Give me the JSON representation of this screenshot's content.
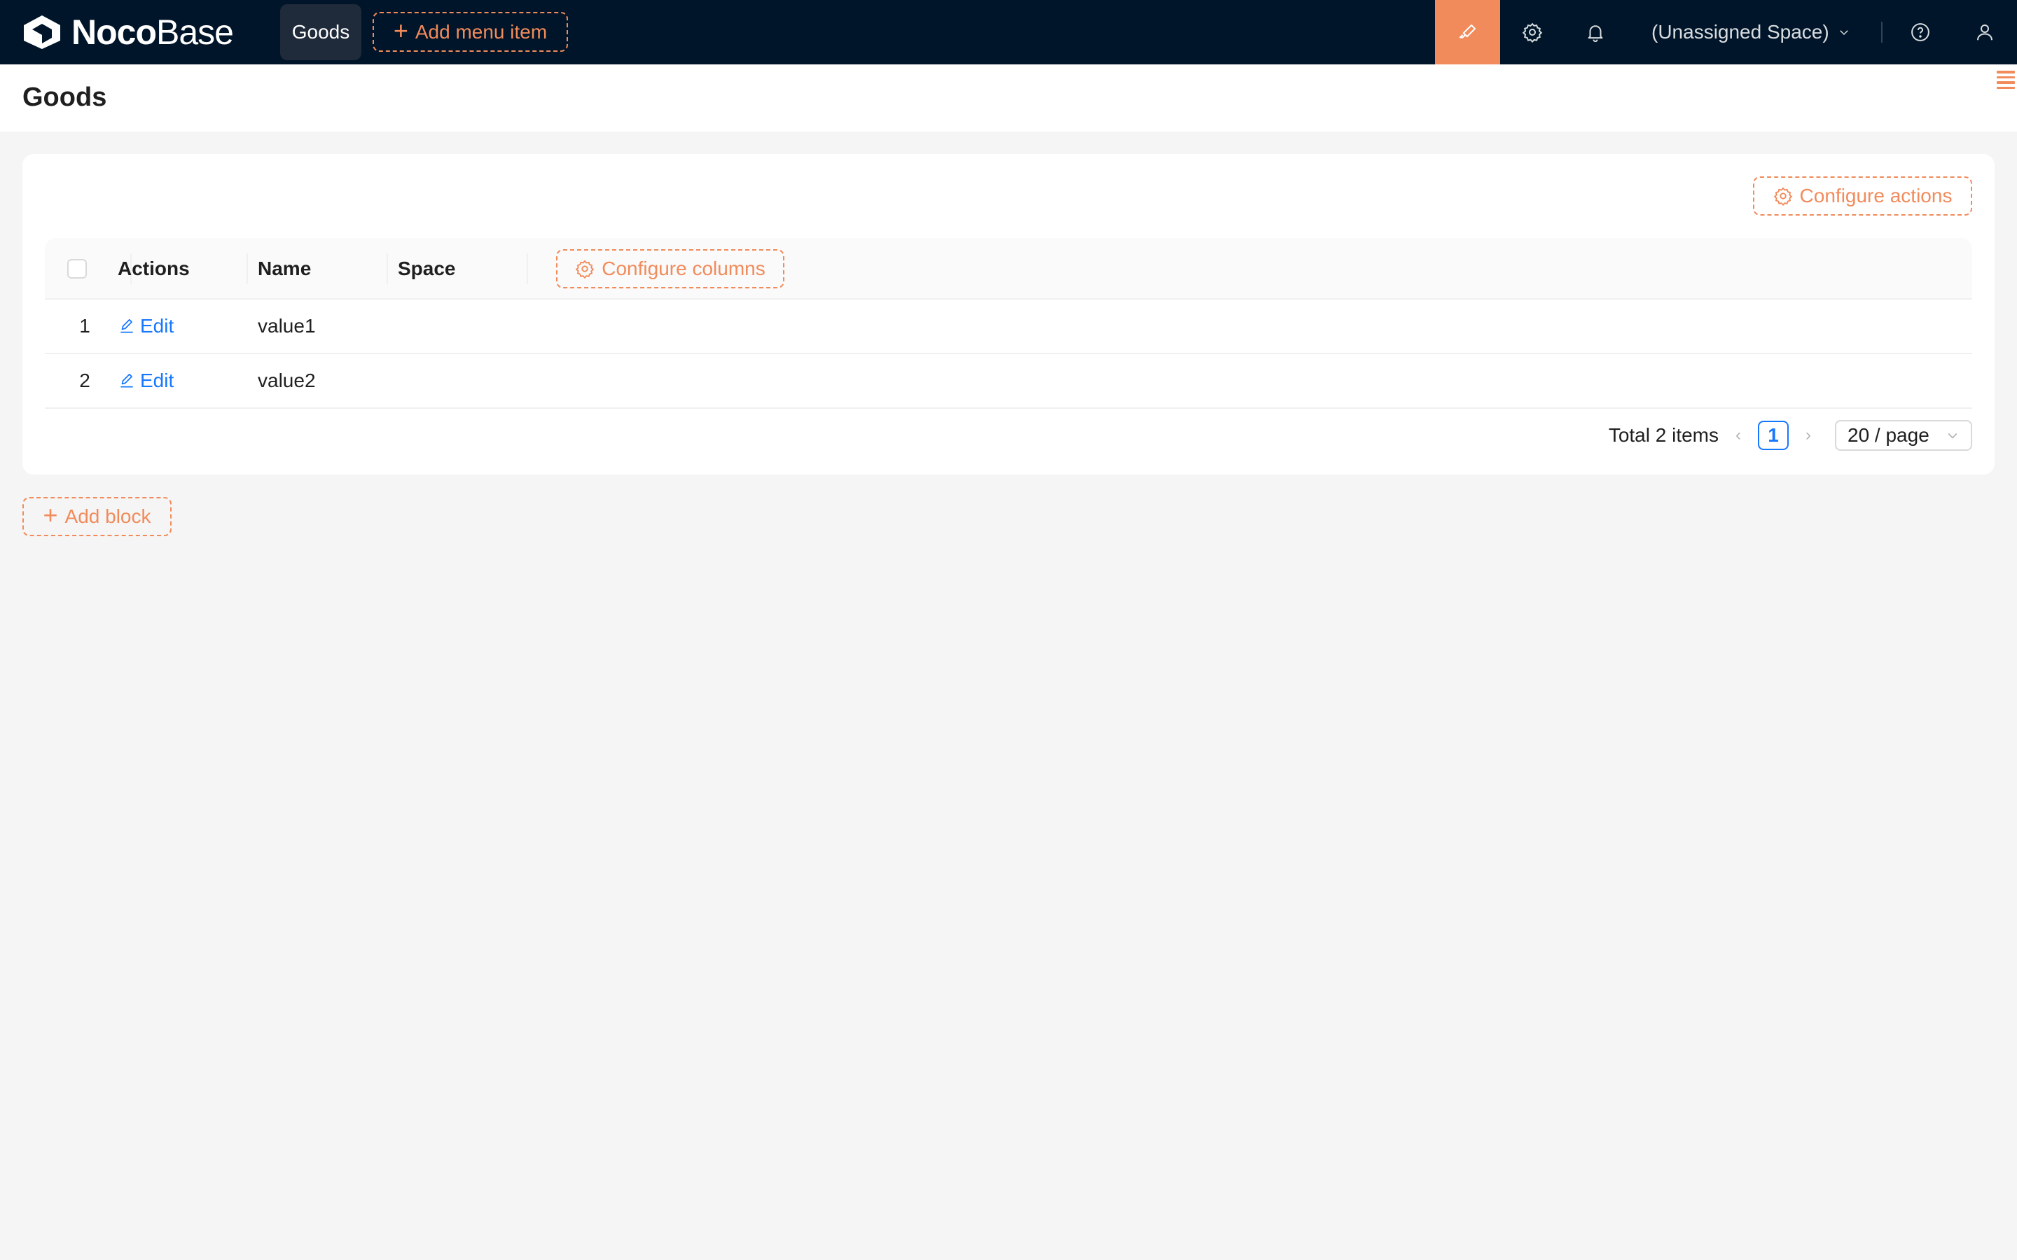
{
  "header": {
    "logo_bold": "Noco",
    "logo_light": "Base",
    "nav_active": "Goods",
    "add_menu_item": "Add menu item",
    "space_selector": "(Unassigned Space)",
    "icons": [
      "ui-editor-icon",
      "settings-icon",
      "bell-icon",
      "help-icon",
      "user-icon"
    ]
  },
  "page": {
    "title": "Goods"
  },
  "card": {
    "configure_actions": "Configure actions",
    "columns": [
      "Actions",
      "Name",
      "Space"
    ],
    "configure_columns": "Configure columns",
    "rows": [
      {
        "index": "1",
        "action": "Edit",
        "name": "value1"
      },
      {
        "index": "2",
        "action": "Edit",
        "name": "value2"
      }
    ],
    "pagination": {
      "total": "Total 2 items",
      "current_page": "1",
      "page_size": "20 / page"
    }
  },
  "add_block": "Add block",
  "colors": {
    "header_bg": "#001529",
    "accent_orange": "#f18b5b",
    "link_blue": "#1677ff",
    "page_bg": "#f5f5f5"
  }
}
